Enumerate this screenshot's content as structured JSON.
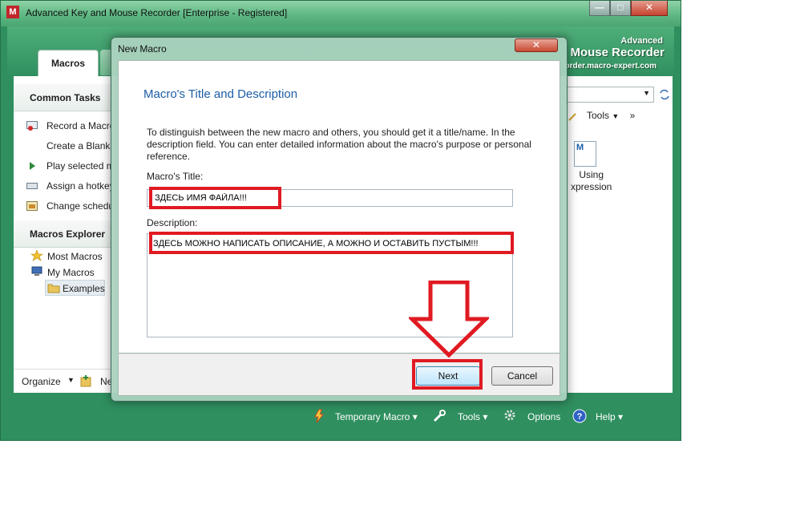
{
  "window": {
    "title": "Advanced Key and Mouse Recorder [Enterprise - Registered]",
    "app_icon_letter": "M",
    "minimize_glyph": "—",
    "maximize_glyph": "□",
    "close_glyph": "✕"
  },
  "brand": {
    "advanced": "Advanced",
    "name": "Mouse Recorder",
    "url": "order.macro-expert.com"
  },
  "tabs": [
    {
      "label": "Macros"
    }
  ],
  "common_tasks": {
    "header": "Common Tasks",
    "items": [
      {
        "label": "Record a Macro",
        "icon": "record-icon"
      },
      {
        "label": "Create a Blank M",
        "icon": "blank-doc-icon"
      },
      {
        "label": "Play selected m",
        "icon": "play-icon"
      },
      {
        "label": "Assign a hotkey",
        "icon": "keyboard-icon"
      },
      {
        "label": "Change schedu",
        "icon": "schedule-icon"
      }
    ]
  },
  "macros_explorer": {
    "header": "Macros Explorer",
    "items": [
      {
        "label": "Most Macros",
        "icon": "star-icon"
      },
      {
        "label": "My Macros",
        "icon": "computer-icon"
      },
      {
        "label": "Examples",
        "icon": "folder-icon"
      }
    ]
  },
  "organize": {
    "label": "Organize",
    "new_label": "Ne"
  },
  "right_panel": {
    "tools_label": "Tools",
    "using_label": "Using\nxpression"
  },
  "bottom_bar": {
    "items": [
      {
        "label": "Temporary Macro",
        "icon": "lightning-icon"
      },
      {
        "label": "Tools",
        "icon": "wrench-icon"
      },
      {
        "label": "Options",
        "icon": "gears-icon"
      },
      {
        "label": "Help",
        "icon": "help-icon"
      }
    ]
  },
  "dialog": {
    "title": "New Macro",
    "close_glyph": "✕",
    "heading": "Macro's Title and Description",
    "instructions": "To distinguish between the new macro and others, you should get it a title/name. In the description field. You can enter detailed information about the macro's purpose or personal reference.",
    "title_label": "Macro's Title:",
    "title_value": "ЗДЕСЬ ИМЯ ФАЙЛА!!!",
    "description_label": "Description:",
    "description_value": "ЗДЕСЬ МОЖНО НАПИСАТЬ ОПИСАНИЕ, А МОЖНО И ОСТАВИТЬ ПУСТЫМ!!!",
    "next_label": "Next",
    "cancel_label": "Cancel"
  },
  "colors": {
    "frame_green": "#2f8f5f",
    "annotation_red": "#e01a22",
    "heading_blue": "#1d5da6"
  }
}
